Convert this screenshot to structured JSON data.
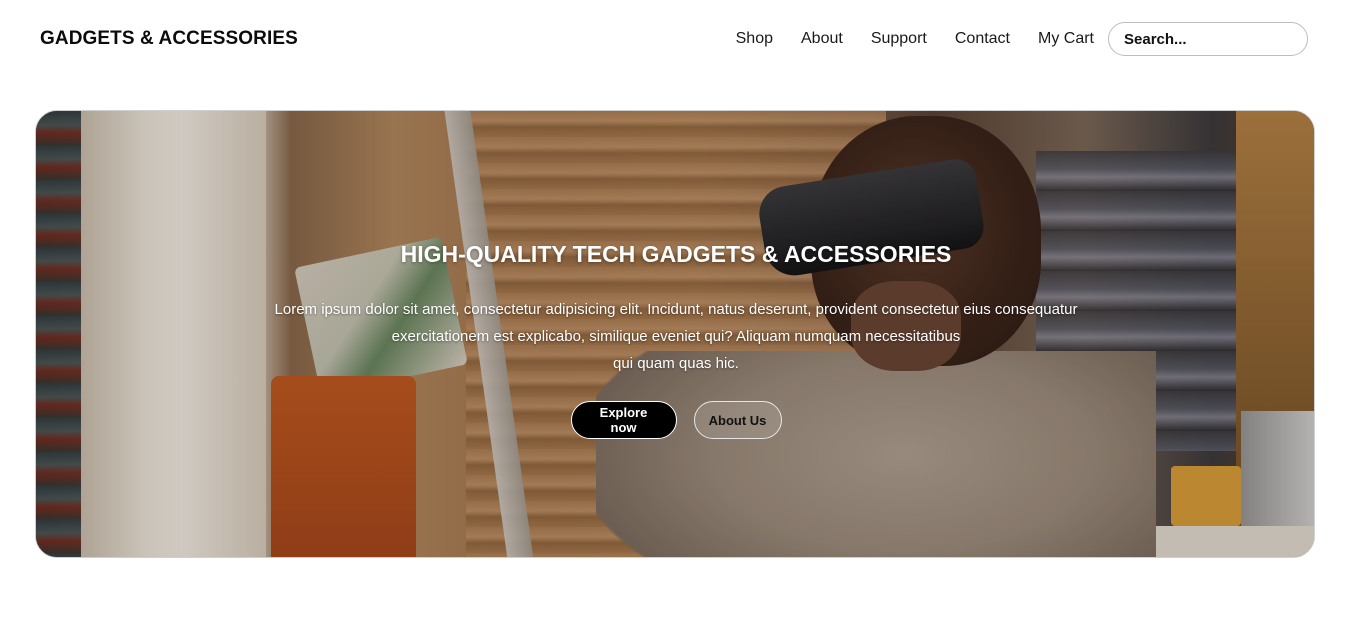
{
  "header": {
    "brand": "GADGETS & ACCESSORIES",
    "nav": [
      "Shop",
      "About",
      "Support",
      "Contact",
      "My Cart"
    ],
    "search_placeholder": "Search..."
  },
  "hero": {
    "title": "HIGH-QUALITY TECH GADGETS & ACCESSORIES",
    "text_lines": [
      "Lorem ipsum dolor sit amet, consectetur adipisicing elit. Incidunt, natus deserunt, provident consectetur eius consequatur",
      "exercitationem est explicabo, similique eveniet qui? Aliquam numquam necessitatibus",
      "qui quam quas hic."
    ],
    "primary_button": "Explore now",
    "secondary_button": "About Us",
    "image_subject": "person-wearing-vr-headset-in-library"
  },
  "colors": {
    "primary_button_bg": "#000000",
    "text_on_hero": "#ffffff",
    "brand_text": "#0c0c0c"
  }
}
